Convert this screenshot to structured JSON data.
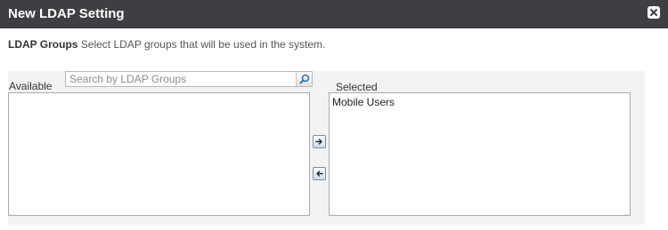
{
  "dialog": {
    "title": "New LDAP Setting",
    "close_icon": "close-icon"
  },
  "description": {
    "heading": "LDAP Groups",
    "text": " Select LDAP groups that will be used in the system."
  },
  "available": {
    "label": "Available",
    "search_placeholder": "Search by LDAP Groups",
    "search_value": "",
    "items": []
  },
  "selected": {
    "label": "Selected",
    "items": [
      "Mobile Users"
    ]
  },
  "buttons": {
    "add_icon": "arrow-right-icon",
    "remove_icon": "arrow-left-icon"
  },
  "colors": {
    "titlebar": "#3e3f42",
    "panel": "#f3f3f3",
    "search_icon": "#2f6fc0"
  }
}
